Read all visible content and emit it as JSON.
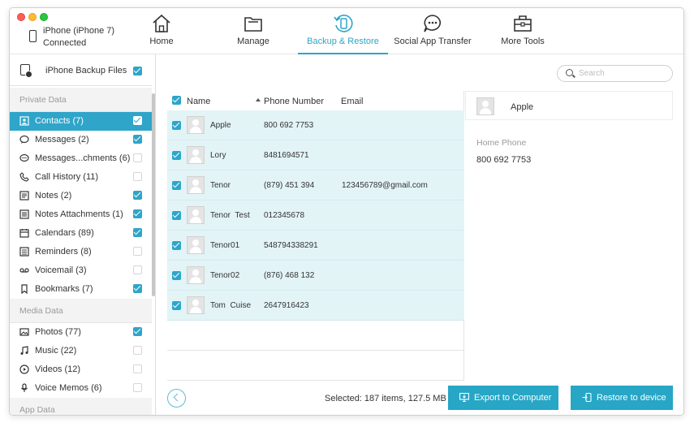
{
  "window": {
    "traffic_lights": [
      "close",
      "minimize",
      "zoom"
    ]
  },
  "device": {
    "name": "iPhone (iPhone 7)",
    "status": "Connected"
  },
  "nav": [
    {
      "label": "Home",
      "icon": "home-icon"
    },
    {
      "label": "Manage",
      "icon": "folder-icon"
    },
    {
      "label": "Backup & Restore",
      "icon": "backup-restore-icon",
      "active": true
    },
    {
      "label": "Social App Transfer",
      "icon": "chat-bubble-icon"
    },
    {
      "label": "More Tools",
      "icon": "toolbox-icon"
    }
  ],
  "sidebar": {
    "backup_files_label": "iPhone Backup Files",
    "sections": [
      {
        "title": "Private Data",
        "items": [
          {
            "label": "Contacts (7)",
            "icon": "contacts-icon",
            "checked": true,
            "active": true
          },
          {
            "label": "Messages (2)",
            "icon": "message-icon",
            "checked": true
          },
          {
            "label": "Messages...chments (6)",
            "icon": "message-attachment-icon",
            "checked": false
          },
          {
            "label": "Call History (11)",
            "icon": "phone-icon",
            "checked": false
          },
          {
            "label": "Notes (2)",
            "icon": "notes-icon",
            "checked": true
          },
          {
            "label": "Notes Attachments (1)",
            "icon": "notes-attachment-icon",
            "checked": true
          },
          {
            "label": "Calendars (89)",
            "icon": "calendar-icon",
            "checked": true
          },
          {
            "label": "Reminders (8)",
            "icon": "reminders-icon",
            "checked": false
          },
          {
            "label": "Voicemail (3)",
            "icon": "voicemail-icon",
            "checked": false
          },
          {
            "label": "Bookmarks (7)",
            "icon": "bookmark-icon",
            "checked": true
          }
        ]
      },
      {
        "title": "Media Data",
        "items": [
          {
            "label": "Photos (77)",
            "icon": "photo-icon",
            "checked": true
          },
          {
            "label": "Music (22)",
            "icon": "music-icon",
            "checked": false
          },
          {
            "label": "Videos (12)",
            "icon": "video-icon",
            "checked": false
          },
          {
            "label": "Voice Memos (6)",
            "icon": "microphone-icon",
            "checked": false
          }
        ]
      },
      {
        "title": "App Data",
        "items": []
      }
    ]
  },
  "search": {
    "placeholder": "Search"
  },
  "table": {
    "headers": {
      "name": "Name",
      "phone": "Phone Number",
      "email": "Email"
    },
    "rows": [
      {
        "name": "Apple",
        "phone": "800 692 7753",
        "email": ""
      },
      {
        "name": "Lory",
        "phone": "8481694571",
        "email": ""
      },
      {
        "name": "Tenor",
        "phone": "(879) 451 394",
        "email": "123456789@gmail.com"
      },
      {
        "name": "Tenor  Test",
        "phone": "012345678",
        "email": ""
      },
      {
        "name": "Tenor01",
        "phone": "548794338291",
        "email": ""
      },
      {
        "name": "Tenor02",
        "phone": "(876) 468 132",
        "email": ""
      },
      {
        "name": "Tom  Cuise",
        "phone": "2647916423",
        "email": ""
      }
    ]
  },
  "detail": {
    "name": "Apple",
    "field_label": "Home Phone",
    "field_value": "800 692 7753"
  },
  "footer": {
    "selected_text": "Selected: 187 items, 127.5 MB",
    "export_label": "Export to Computer",
    "restore_label": "Restore to device"
  },
  "colors": {
    "accent": "#2ea5c9",
    "row_bg": "#e3f4f7",
    "button": "#27a6c6"
  }
}
